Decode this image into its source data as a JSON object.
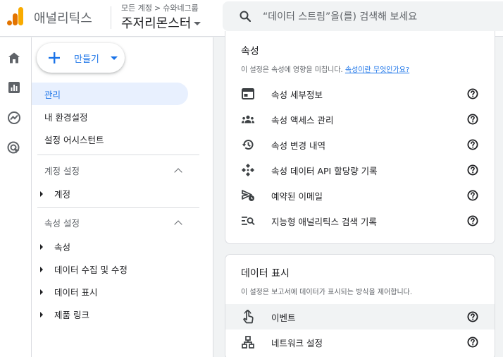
{
  "header": {
    "app_name": "애널리틱스",
    "breadcrumb": {
      "parent": "모든 계정",
      "separator": ">",
      "account": "슈와네그룹"
    },
    "property_name": "주저리몬스터",
    "search_placeholder": "“데이터 스트림”을(를) 검색해 보세요"
  },
  "rail": {
    "items": [
      {
        "icon": "home-icon"
      },
      {
        "icon": "reports-icon"
      },
      {
        "icon": "explore-icon"
      },
      {
        "icon": "advertising-icon"
      }
    ]
  },
  "nav": {
    "create_label": "만들기",
    "top_items": [
      "관리",
      "내 환경설정",
      "설정 어시스턴트"
    ],
    "account_section": {
      "title": "계정 설정",
      "items": [
        "계정"
      ]
    },
    "property_section": {
      "title": "속성 설정",
      "items": [
        "속성",
        "데이터 수집 및 수정",
        "데이터 표시",
        "제품 링크"
      ]
    }
  },
  "property_card": {
    "title": "속성",
    "desc": "이 설정은 속성에 영향을 미칩니다.",
    "desc_link": "속성이란 무엇인가요?",
    "rows": [
      {
        "label": "속성 세부정보",
        "icon": "property-details-icon"
      },
      {
        "label": "속성 액세스 관리",
        "icon": "people-icon"
      },
      {
        "label": "속성 변경 내역",
        "icon": "history-icon"
      },
      {
        "label": "속성 데이터 API 할당량 기록",
        "icon": "api-icon"
      },
      {
        "label": "예약된 이메일",
        "icon": "scheduled-email-icon"
      },
      {
        "label": "지능형 애널리틱스 검색 기록",
        "icon": "search-history-icon"
      }
    ]
  },
  "display_card": {
    "title": "데이터 표시",
    "desc": "이 설정은 보고서에 데이터가 표시되는 방식을 제어합니다.",
    "rows": [
      {
        "label": "이벤트",
        "icon": "touch-icon"
      },
      {
        "label": "네트워크 설정",
        "icon": "network-icon"
      }
    ]
  },
  "colors": {
    "accent": "#1a73e8",
    "active_bg": "#e8f0fe",
    "logo_orange": "#f9ab00",
    "logo_dark": "#e37400"
  }
}
